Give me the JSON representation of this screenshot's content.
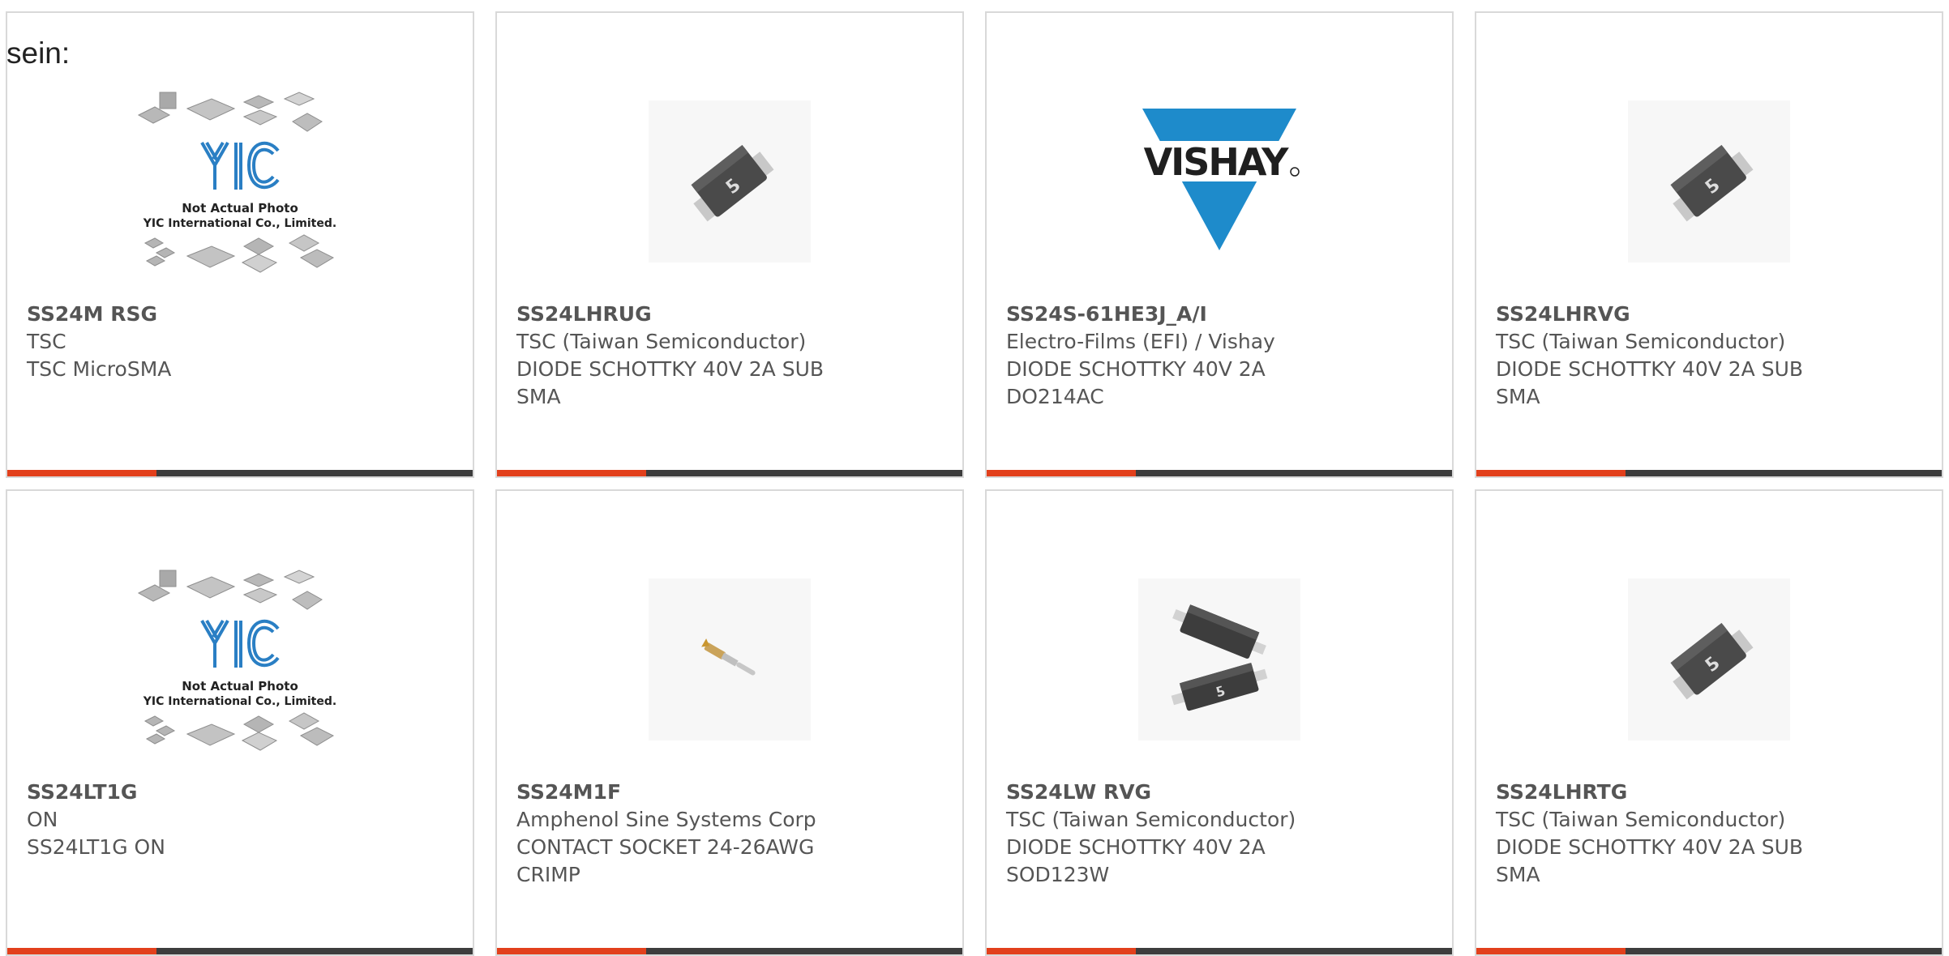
{
  "intro_text": "sein:",
  "colors": {
    "accent": "#e2401c",
    "bar_dark": "#3d3d3d",
    "card_border": "#d9d9d9",
    "text": "#555555",
    "vishay_blue": "#1e8bcb"
  },
  "placeholder_image": {
    "logo_text": "YIC",
    "caption_line1": "Not Actual Photo",
    "caption_line2": "YIC International Co., Limited."
  },
  "vishay_logo_text": "VISHAY",
  "products": [
    {
      "part": "SS24M RSG",
      "manufacturer": "TSC",
      "description": "TSC MicroSMA",
      "description2": "",
      "image": "yic-placeholder-icon"
    },
    {
      "part": "SS24LHRUG",
      "manufacturer": "TSC (Taiwan Semiconductor)",
      "description": "DIODE SCHOTTKY 40V 2A SUB",
      "description2": "SMA",
      "image": "smd-diode-icon"
    },
    {
      "part": "SS24S-61HE3J_A/I",
      "manufacturer": "Electro-Films (EFI) / Vishay",
      "description": "DIODE SCHOTTKY 40V 2A",
      "description2": "DO214AC",
      "image": "vishay-logo-icon"
    },
    {
      "part": "SS24LHRVG",
      "manufacturer": "TSC (Taiwan Semiconductor)",
      "description": "DIODE SCHOTTKY 40V 2A SUB",
      "description2": "SMA",
      "image": "smd-diode-icon"
    },
    {
      "part": "SS24LT1G",
      "manufacturer": "ON",
      "description": "SS24LT1G ON",
      "description2": "",
      "image": "yic-placeholder-icon"
    },
    {
      "part": "SS24M1F",
      "manufacturer": "Amphenol Sine Systems Corp",
      "description": "CONTACT SOCKET 24-26AWG",
      "description2": "CRIMP",
      "image": "crimp-contact-icon"
    },
    {
      "part": "SS24LW RVG",
      "manufacturer": "TSC (Taiwan Semiconductor)",
      "description": "DIODE SCHOTTKY 40V 2A",
      "description2": "SOD123W",
      "image": "dual-smd-diode-icon"
    },
    {
      "part": "SS24LHRTG",
      "manufacturer": "TSC (Taiwan Semiconductor)",
      "description": "DIODE SCHOTTKY 40V 2A SUB",
      "description2": "SMA",
      "image": "smd-diode-icon"
    }
  ]
}
